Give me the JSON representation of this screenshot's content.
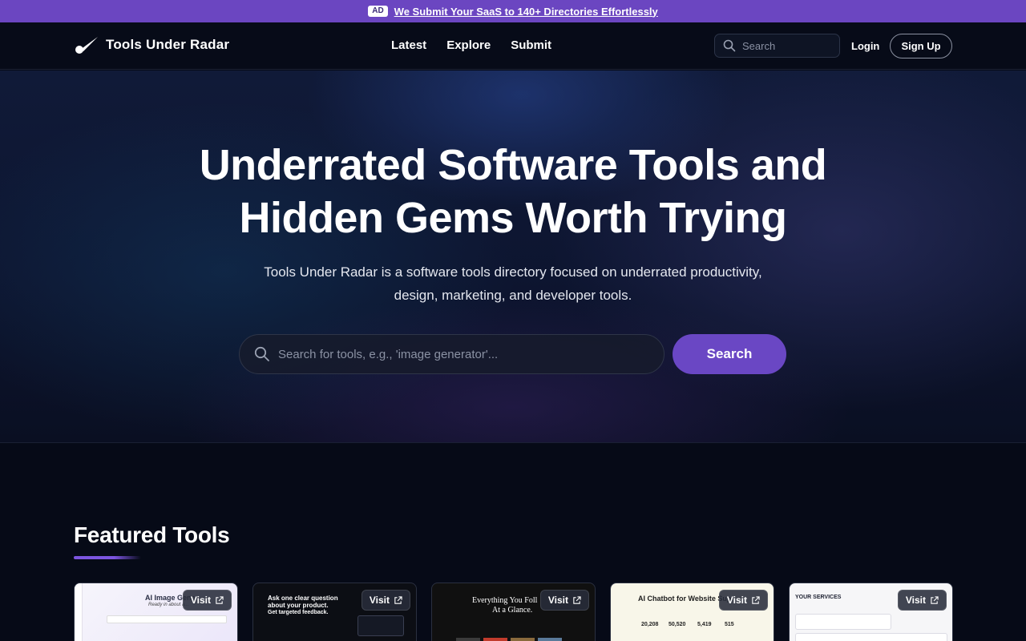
{
  "ad": {
    "badge": "AD",
    "text": "We Submit Your SaaS to 140+ Directories Effortlessly"
  },
  "nav": {
    "brand": "Tools Under Radar",
    "links": [
      "Latest",
      "Explore",
      "Submit"
    ],
    "search_placeholder": "Search",
    "login": "Login",
    "signup": "Sign Up"
  },
  "hero": {
    "title_line1": "Underrated Software Tools and",
    "title_line2": "Hidden Gems Worth Trying",
    "subtitle_line1": "Tools Under Radar is a software tools directory focused on underrated productivity,",
    "subtitle_line2": "design, marketing, and developer tools.",
    "search_placeholder": "Search for tools, e.g., 'image generator'...",
    "search_button": "Search"
  },
  "featured": {
    "title": "Featured Tools",
    "cards": [
      {
        "visit": "Visit",
        "thumb_text": "AI Image Gene",
        "thumb_sub": "Ready in about a..."
      },
      {
        "visit": "Visit",
        "thumb_text": "Ask one clear question about your product.",
        "thumb_sub": "Get targeted feedback."
      },
      {
        "visit": "Visit",
        "thumb_text": "Everything You Foll",
        "thumb_sub": "At a Glance."
      },
      {
        "visit": "Visit",
        "thumb_text": "AI Chatbot for Website Sup",
        "stats": [
          "20,208",
          "50,520",
          "5,419",
          "515"
        ]
      },
      {
        "visit": "Visit",
        "thumb_text": "YOUR SERVICES"
      }
    ]
  },
  "colors": {
    "accent": "#6a47c4",
    "ad_bar": "#6b46c1",
    "background": "#060a17"
  },
  "icons": {
    "logo": "comet-icon",
    "search": "search-icon",
    "external": "external-link-icon"
  }
}
